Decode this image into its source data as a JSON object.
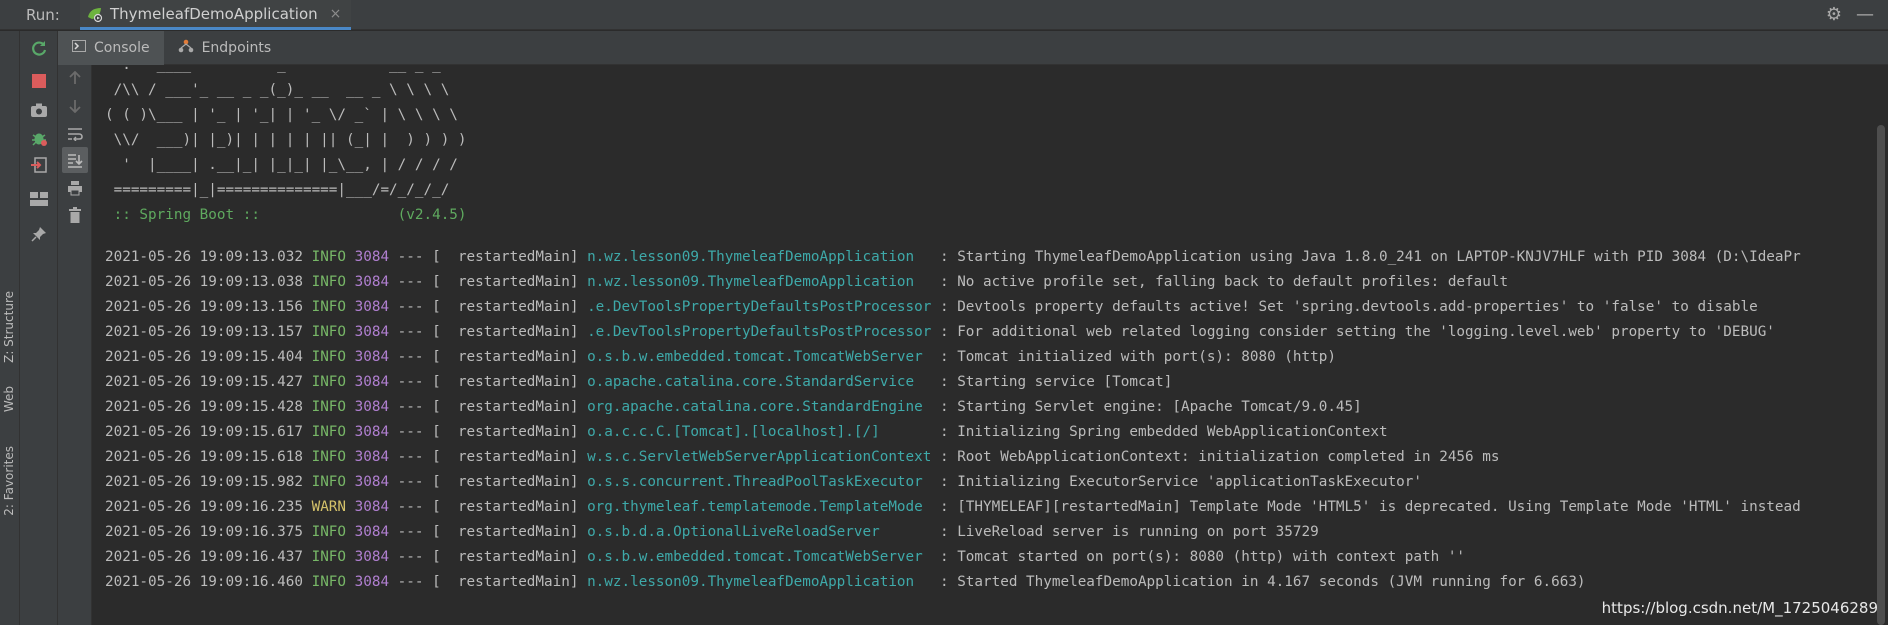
{
  "header": {
    "run_label": "Run:",
    "tab_title": "ThymeleafDemoApplication",
    "close_glyph": "×",
    "settings_glyph": "⚙",
    "minimize_glyph": "—"
  },
  "subtabs": [
    {
      "label": "Console",
      "icon": "console-icon"
    },
    {
      "label": "Endpoints",
      "icon": "endpoints-icon"
    }
  ],
  "side_labels": {
    "structure": "Z: Structure",
    "web": "Web",
    "favorites": "2: Favorites"
  },
  "banner": [
    "  .   ____          _            __ _ _",
    " /\\\\ / ___'_ __ _ _(_)_ __  __ _ \\ \\ \\ \\",
    "( ( )\\___ | '_ | '_| | '_ \\/ _` | \\ \\ \\ \\",
    " \\\\/  ___)| |_)| | | | | || (_| |  ) ) ) )",
    "  '  |____| .__|_| |_|_| |_\\__, | / / / /",
    " =========|_|==============|___/=/_/_/_/"
  ],
  "spring_line": " :: Spring Boot ::                (v2.4.5)",
  "logs": [
    {
      "ts": "2021-05-26 19:09:13.032",
      "level": "INFO",
      "pid": "3084",
      "thread": " --- [  restartedMain] ",
      "logger": "n.wz.lesson09.ThymeleafDemoApplication  ",
      "msg": " : Starting ThymeleafDemoApplication using Java 1.8.0_241 on LAPTOP-KNJV7HLF with PID 3084 (D:\\IdeaPr"
    },
    {
      "ts": "2021-05-26 19:09:13.038",
      "level": "INFO",
      "pid": "3084",
      "thread": " --- [  restartedMain] ",
      "logger": "n.wz.lesson09.ThymeleafDemoApplication  ",
      "msg": " : No active profile set, falling back to default profiles: default"
    },
    {
      "ts": "2021-05-26 19:09:13.156",
      "level": "INFO",
      "pid": "3084",
      "thread": " --- [  restartedMain] ",
      "logger": ".e.DevToolsPropertyDefaultsPostProcessor",
      "msg": " : Devtools property defaults active! Set 'spring.devtools.add-properties' to 'false' to disable"
    },
    {
      "ts": "2021-05-26 19:09:13.157",
      "level": "INFO",
      "pid": "3084",
      "thread": " --- [  restartedMain] ",
      "logger": ".e.DevToolsPropertyDefaultsPostProcessor",
      "msg": " : For additional web related logging consider setting the 'logging.level.web' property to 'DEBUG'"
    },
    {
      "ts": "2021-05-26 19:09:15.404",
      "level": "INFO",
      "pid": "3084",
      "thread": " --- [  restartedMain] ",
      "logger": "o.s.b.w.embedded.tomcat.TomcatWebServer ",
      "msg": " : Tomcat initialized with port(s): 8080 (http)"
    },
    {
      "ts": "2021-05-26 19:09:15.427",
      "level": "INFO",
      "pid": "3084",
      "thread": " --- [  restartedMain] ",
      "logger": "o.apache.catalina.core.StandardService  ",
      "msg": " : Starting service [Tomcat]"
    },
    {
      "ts": "2021-05-26 19:09:15.428",
      "level": "INFO",
      "pid": "3084",
      "thread": " --- [  restartedMain] ",
      "logger": "org.apache.catalina.core.StandardEngine ",
      "msg": " : Starting Servlet engine: [Apache Tomcat/9.0.45]"
    },
    {
      "ts": "2021-05-26 19:09:15.617",
      "level": "INFO",
      "pid": "3084",
      "thread": " --- [  restartedMain] ",
      "logger": "o.a.c.c.C.[Tomcat].[localhost].[/]      ",
      "msg": " : Initializing Spring embedded WebApplicationContext"
    },
    {
      "ts": "2021-05-26 19:09:15.618",
      "level": "INFO",
      "pid": "3084",
      "thread": " --- [  restartedMain] ",
      "logger": "w.s.c.ServletWebServerApplicationContext",
      "msg": " : Root WebApplicationContext: initialization completed in 2456 ms"
    },
    {
      "ts": "2021-05-26 19:09:15.982",
      "level": "INFO",
      "pid": "3084",
      "thread": " --- [  restartedMain] ",
      "logger": "o.s.s.concurrent.ThreadPoolTaskExecutor ",
      "msg": " : Initializing ExecutorService 'applicationTaskExecutor'"
    },
    {
      "ts": "2021-05-26 19:09:16.235",
      "level": "WARN",
      "pid": "3084",
      "thread": " --- [  restartedMain] ",
      "logger": "org.thymeleaf.templatemode.TemplateMode ",
      "msg": " : [THYMELEAF][restartedMain] Template Mode 'HTML5' is deprecated. Using Template Mode 'HTML' instead"
    },
    {
      "ts": "2021-05-26 19:09:16.375",
      "level": "INFO",
      "pid": "3084",
      "thread": " --- [  restartedMain] ",
      "logger": "o.s.b.d.a.OptionalLiveReloadServer      ",
      "msg": " : LiveReload server is running on port 35729"
    },
    {
      "ts": "2021-05-26 19:09:16.437",
      "level": "INFO",
      "pid": "3084",
      "thread": " --- [  restartedMain] ",
      "logger": "o.s.b.w.embedded.tomcat.TomcatWebServer ",
      "msg": " : Tomcat started on port(s): 8080 (http) with context path ''"
    },
    {
      "ts": "2021-05-26 19:09:16.460",
      "level": "INFO",
      "pid": "3084",
      "thread": " --- [  restartedMain] ",
      "logger": "n.wz.lesson09.ThymeleafDemoApplication  ",
      "msg": " : Started ThymeleafDemoApplication in 4.167 seconds (JVM running for 6.663)"
    }
  ],
  "watermark": "https://blog.csdn.net/M_1725046289"
}
